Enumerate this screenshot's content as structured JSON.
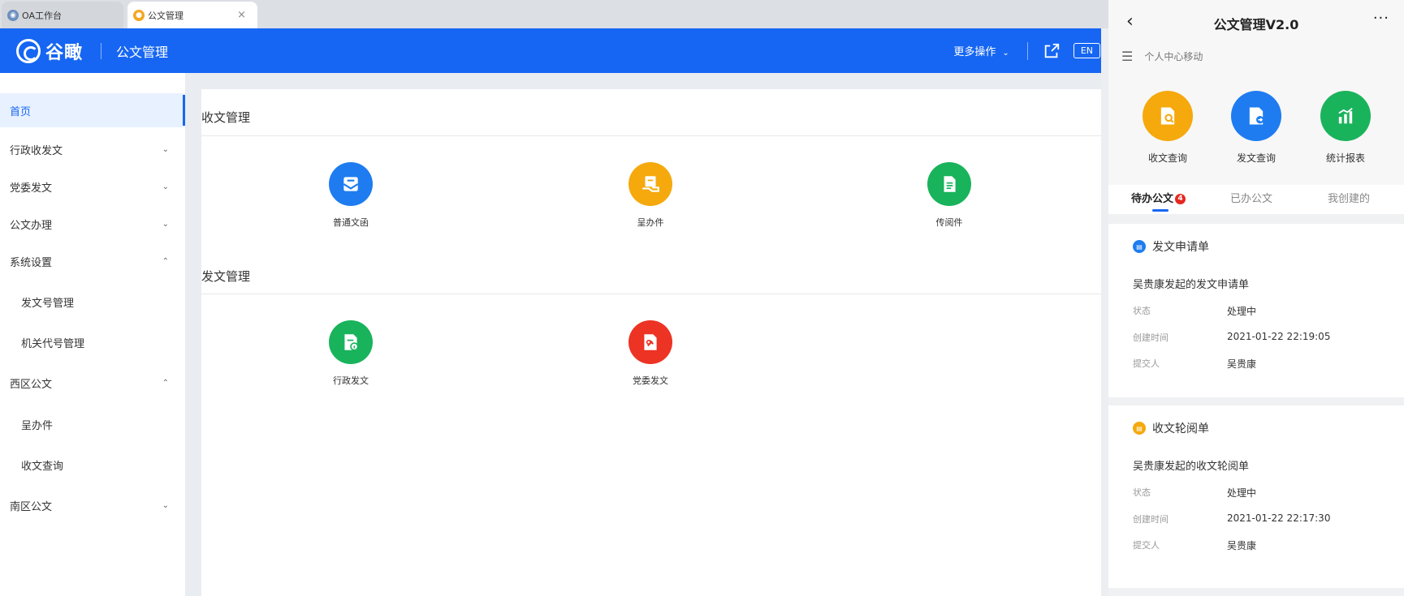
{
  "browser_tabs": [
    {
      "label": "OA工作台",
      "icon": "oa-globe-icon"
    },
    {
      "label": "公文管理",
      "icon": "app-circle-icon",
      "close": "×"
    }
  ],
  "header": {
    "logo_text": "谷瞰",
    "module_title": "公文管理",
    "more_ops": "更多操作",
    "lang_button": "EN",
    "color": "#1666f3"
  },
  "sidebar": {
    "items": [
      {
        "label": "首页",
        "arrow": ""
      },
      {
        "label": "行政收发文",
        "arrow": "⌄"
      },
      {
        "label": "党委发文",
        "arrow": "⌄"
      },
      {
        "label": "公文办理",
        "arrow": "⌄"
      },
      {
        "label": "系统设置",
        "arrow": "⌃"
      },
      {
        "label": "发文号管理",
        "arrow": ""
      },
      {
        "label": "机关代号管理",
        "arrow": ""
      },
      {
        "label": "西区公文",
        "arrow": "⌃"
      },
      {
        "label": "呈办件",
        "arrow": ""
      },
      {
        "label": "收文查询",
        "arrow": ""
      },
      {
        "label": "南区公文",
        "arrow": "⌄"
      }
    ]
  },
  "main": {
    "receive_section": {
      "title": "收文管理",
      "apps": [
        {
          "label": "普通文函",
          "color": "#1e7cf0"
        },
        {
          "label": "呈办件",
          "color": "#f5a90d"
        },
        {
          "label": "传阅件",
          "color": "#19b35b"
        }
      ]
    },
    "send_section": {
      "title": "发文管理",
      "apps": [
        {
          "label": "行政发文",
          "color": "#19b35b"
        },
        {
          "label": "党委发文",
          "color": "#ec3324"
        }
      ]
    }
  },
  "mobile": {
    "back": "‹",
    "title": "公文管理V2.0",
    "more": "···",
    "subtitle": "个人中心移动",
    "apps": [
      {
        "label": "收文查询",
        "color": "#f5a90d"
      },
      {
        "label": "发文查询",
        "color": "#1e7cf0"
      },
      {
        "label": "统计报表",
        "color": "#19b35b"
      }
    ],
    "tabs": [
      {
        "label": "待办公文",
        "badge": "4"
      },
      {
        "label": "已办公文"
      },
      {
        "label": "我创建的"
      }
    ],
    "cards": [
      {
        "type": "发文申请单",
        "dot_color": "#1e7cf0",
        "desc": "吴贵康发起的发文申请单",
        "rows": [
          {
            "k": "状态",
            "v": "处理中"
          },
          {
            "k": "创建时间",
            "v": "2021-01-22 22:19:05"
          },
          {
            "k": "提交人",
            "v": "吴贵康"
          }
        ]
      },
      {
        "type": "收文轮阅单",
        "dot_color": "#f5a90d",
        "desc": "吴贵康发起的收文轮阅单",
        "rows": [
          {
            "k": "状态",
            "v": "处理中"
          },
          {
            "k": "创建时间",
            "v": "2021-01-22 22:17:30"
          },
          {
            "k": "提交人",
            "v": "吴贵康"
          }
        ]
      }
    ]
  }
}
